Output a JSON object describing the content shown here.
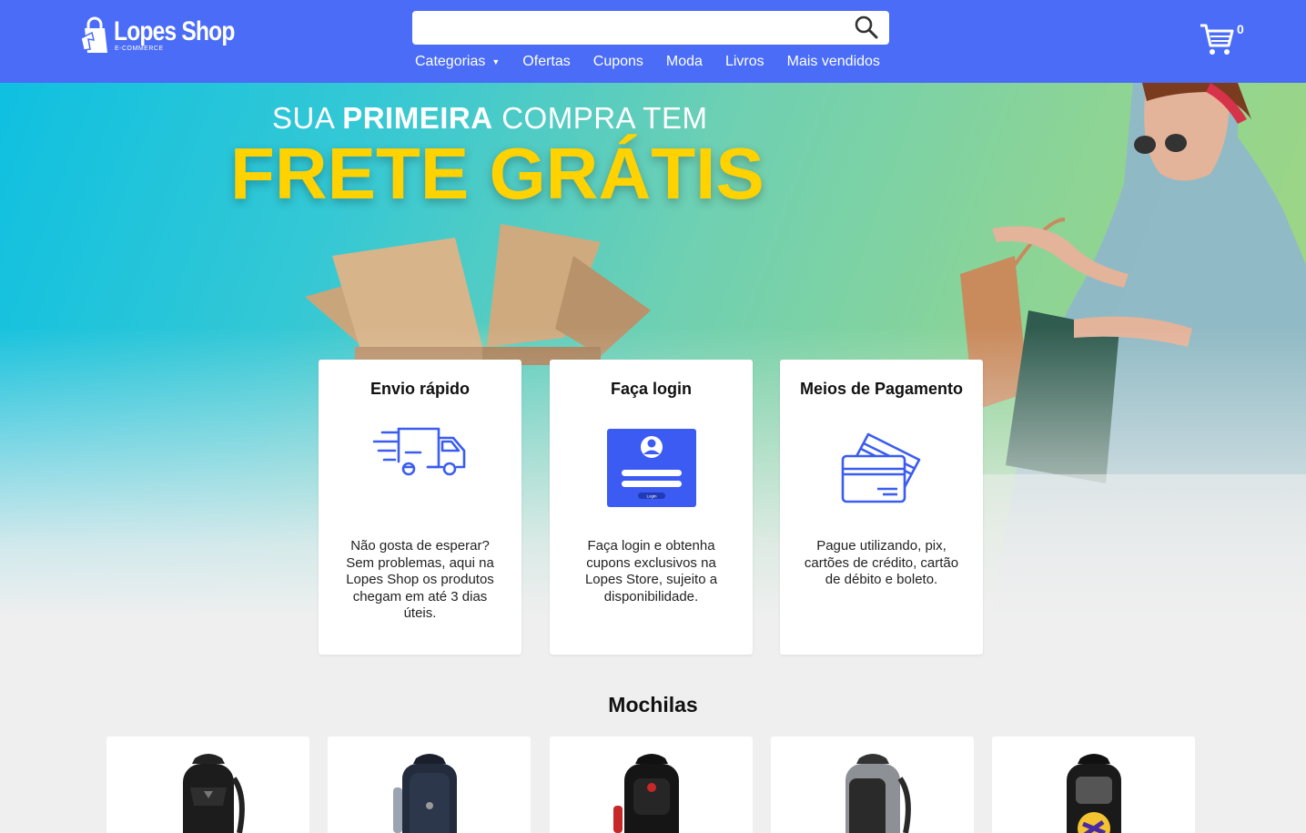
{
  "header": {
    "brand_name": "Lopes Shop",
    "brand_tagline": "E-COMMERCE",
    "search": {
      "value": "",
      "placeholder": ""
    },
    "nav": [
      {
        "label": "Categorias",
        "has_dropdown": true
      },
      {
        "label": "Ofertas"
      },
      {
        "label": "Cupons"
      },
      {
        "label": "Moda"
      },
      {
        "label": "Livros"
      },
      {
        "label": "Mais vendidos"
      }
    ],
    "cart_count": "0",
    "accent_color": "#4a6cf7"
  },
  "hero": {
    "line1_regular_a": "SUA ",
    "line1_bold": "PRIMEIRA",
    "line1_regular_b": " COMPRA TEM",
    "line2": "FRETE GRÁTIS",
    "highlight_color": "#ffd200"
  },
  "features": [
    {
      "title": "Envio rápido",
      "icon": "delivery-truck-icon",
      "text": "Não gosta de esperar? Sem problemas, aqui na Lopes Shop os produtos chegam em até 3 dias úteis."
    },
    {
      "title": "Faça login",
      "icon": "login-screen-icon",
      "text": "Faça login e obtenha cupons exclusivos na Lopes Store, sujeito a disponibilidade.",
      "icon_button_label": "Login"
    },
    {
      "title": "Meios de Pagamento",
      "icon": "credit-cards-icon",
      "text": "Pague utilizando, pix, cartões de crédito, cartão de débito e boleto."
    }
  ],
  "section": {
    "title": "Mochilas",
    "products": [
      {
        "image": "backpack-black-icon"
      },
      {
        "image": "backpack-navy-icon"
      },
      {
        "image": "backpack-swiss-icon"
      },
      {
        "image": "backpack-grey-icon"
      },
      {
        "image": "backpack-sport-icon"
      }
    ]
  }
}
